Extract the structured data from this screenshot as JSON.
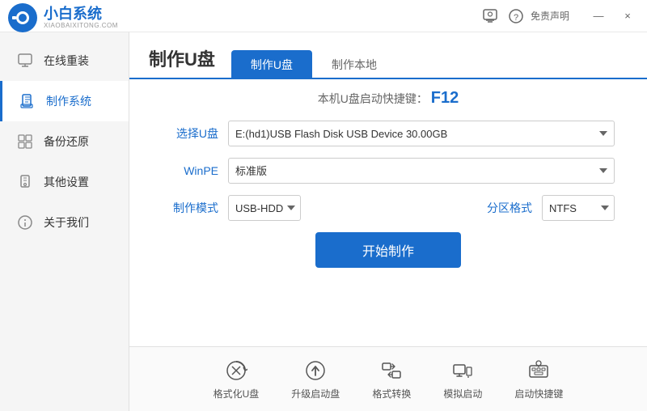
{
  "titlebar": {
    "logo_text": "小白系统",
    "logo_sub": "XIAOBAIXITONG.COM",
    "free_label": "免责声明",
    "minimize_label": "—",
    "close_label": "×"
  },
  "sidebar": {
    "items": [
      {
        "id": "online-reinstall",
        "label": "在线重装",
        "icon": "🖥"
      },
      {
        "id": "make-system",
        "label": "制作系统",
        "icon": "💾"
      },
      {
        "id": "backup-restore",
        "label": "备份还原",
        "icon": "🗂"
      },
      {
        "id": "other-settings",
        "label": "其他设置",
        "icon": "🔒"
      },
      {
        "id": "about-us",
        "label": "关于我们",
        "icon": "ℹ"
      }
    ],
    "active": "make-system"
  },
  "content": {
    "page_title": "制作U盘",
    "tabs": [
      {
        "id": "make-usb",
        "label": "制作U盘",
        "active": true
      },
      {
        "id": "make-local",
        "label": "制作本地",
        "active": false
      }
    ],
    "shortcut_hint": "本机U盘启动快捷键：",
    "shortcut_key": "F12",
    "form": {
      "usb_label": "选择U盘",
      "usb_value": "E:(hd1)USB Flash Disk USB Device 30.00GB",
      "winpe_label": "WinPE",
      "winpe_value": "标准版",
      "mode_label": "制作模式",
      "mode_value": "USB-HDD",
      "partition_label": "分区格式",
      "partition_value": "NTFS",
      "start_btn": "开始制作"
    },
    "toolbar": {
      "items": [
        {
          "id": "format-usb",
          "label": "格式化U盘",
          "icon": "format"
        },
        {
          "id": "upgrade-boot",
          "label": "升级启动盘",
          "icon": "upload"
        },
        {
          "id": "format-convert",
          "label": "格式转换",
          "icon": "convert"
        },
        {
          "id": "simulate-boot",
          "label": "模拟启动",
          "icon": "simulate"
        },
        {
          "id": "boot-shortcut",
          "label": "启动快捷键",
          "icon": "keyboard"
        }
      ]
    }
  }
}
